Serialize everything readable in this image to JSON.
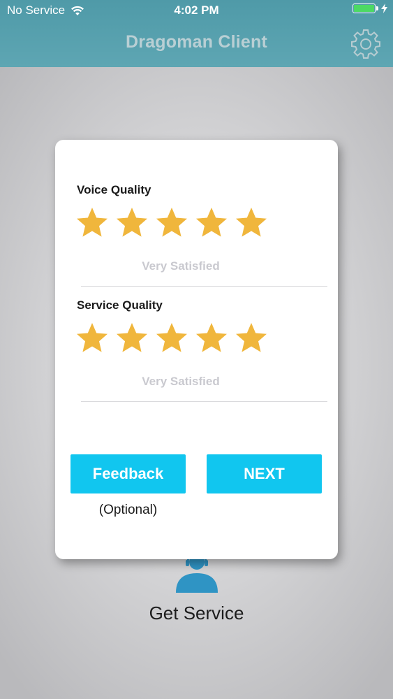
{
  "status_bar": {
    "carrier": "No Service",
    "time": "4:02 PM",
    "battery_color": "#4cd964"
  },
  "header": {
    "title": "Dragoman Client",
    "settings_icon": "gear-icon",
    "background_color": "#5aa2b0"
  },
  "background": {
    "service_icon": "agent-headset-icon",
    "service_label": "Get Service"
  },
  "rating_card": {
    "voice_quality": {
      "label": "Voice Quality",
      "rating": 5,
      "max_rating": 5,
      "rating_text": "Very Satisfied"
    },
    "service_quality": {
      "label": "Service Quality",
      "rating": 5,
      "max_rating": 5,
      "rating_text": "Very Satisfied"
    },
    "star_color": "#f0b63c",
    "feedback_button": "Feedback",
    "feedback_note": "(Optional)",
    "next_button": "NEXT",
    "button_color": "#11c6ef"
  }
}
